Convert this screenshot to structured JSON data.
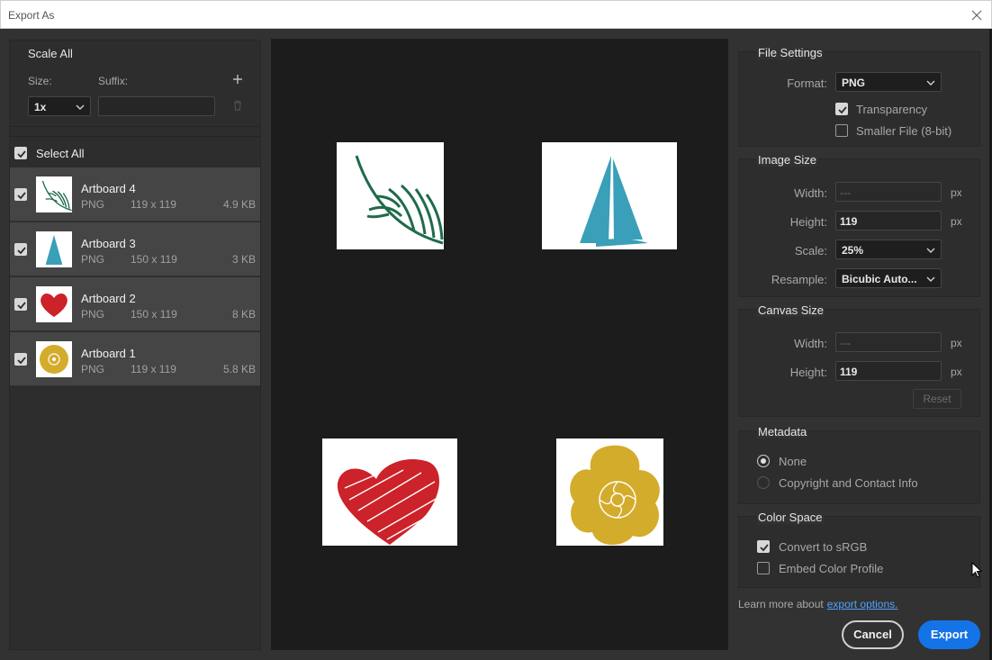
{
  "window": {
    "title": "Export As"
  },
  "scale_all": {
    "title": "Scale All",
    "size_label": "Size:",
    "suffix_label": "Suffix:",
    "size_value": "1x",
    "suffix_value": "",
    "add_icon": "plus-icon",
    "delete_icon": "trash-icon"
  },
  "list": {
    "select_all_label": "Select All",
    "select_all_checked": true,
    "items": [
      {
        "name": "Artboard 4",
        "format": "PNG",
        "dims": "119 x 119",
        "size": "4.9 KB",
        "checked": true
      },
      {
        "name": "Artboard 3",
        "format": "PNG",
        "dims": "150 x 119",
        "size": "3 KB",
        "checked": true
      },
      {
        "name": "Artboard 2",
        "format": "PNG",
        "dims": "150 x 119",
        "size": "8 KB",
        "checked": true
      },
      {
        "name": "Artboard 1",
        "format": "PNG",
        "dims": "119 x 119",
        "size": "5.8 KB",
        "checked": true
      }
    ]
  },
  "file_settings": {
    "title": "File Settings",
    "format_label": "Format:",
    "format_value": "PNG",
    "transparency_label": "Transparency",
    "transparency_checked": true,
    "smaller_file_label": "Smaller File (8-bit)",
    "smaller_file_checked": false
  },
  "image_size": {
    "title": "Image Size",
    "width_label": "Width:",
    "width_value": "---",
    "height_label": "Height:",
    "height_value": "119",
    "unit": "px",
    "scale_label": "Scale:",
    "scale_value": "25%",
    "resample_label": "Resample:",
    "resample_value": "Bicubic Auto..."
  },
  "canvas_size": {
    "title": "Canvas Size",
    "width_label": "Width:",
    "width_value": "---",
    "height_label": "Height:",
    "height_value": "119",
    "unit": "px",
    "reset_label": "Reset"
  },
  "metadata": {
    "title": "Metadata",
    "options": [
      "None",
      "Copyright and Contact Info"
    ],
    "selected": "None"
  },
  "color_space": {
    "title": "Color Space",
    "convert_label": "Convert to sRGB",
    "convert_checked": true,
    "embed_label": "Embed Color Profile",
    "embed_checked": false
  },
  "footer": {
    "learn_text": "Learn more about",
    "learn_link": "export options.",
    "cancel_label": "Cancel",
    "export_label": "Export"
  },
  "colors": {
    "dialog_bg": "#323232",
    "preview_bg": "#1c1c1c",
    "accent": "#1473e6",
    "link": "#4ea3ff",
    "leaf": "#1f6b4a",
    "sail": "#3a9fb8",
    "heart": "#cc2229",
    "flower": "#d4ac2c"
  }
}
